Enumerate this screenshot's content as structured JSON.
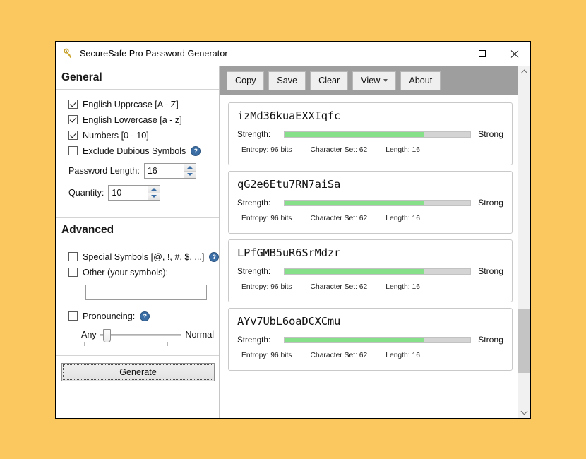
{
  "window": {
    "title": "SecureSafe Pro Password Generator",
    "icon": "key-icon",
    "controls": {
      "minimize": "minimize-icon",
      "maximize": "maximize-icon",
      "close": "close-icon"
    }
  },
  "sidebar": {
    "general": {
      "heading": "General",
      "checkboxes": [
        {
          "label": "English Upprcase [A - Z]",
          "checked": true,
          "help": false
        },
        {
          "label": "English Lowercase [a - z]",
          "checked": true,
          "help": false
        },
        {
          "label": "Numbers [0 - 10]",
          "checked": true,
          "help": false
        },
        {
          "label": "Exclude Dubious Symbols",
          "checked": false,
          "help": true
        }
      ],
      "fields": [
        {
          "label": "Password Length:",
          "value": "16"
        },
        {
          "label": "Quantity:",
          "value": "10"
        }
      ]
    },
    "advanced": {
      "heading": "Advanced",
      "checkboxes": [
        {
          "label": "Special Symbols [@, !, #, $, ...]",
          "checked": false,
          "help": true
        },
        {
          "label": "Other (your symbols):",
          "checked": false,
          "help": false
        }
      ],
      "symbols_input": {
        "value": "",
        "placeholder": ""
      },
      "pronouncing": {
        "label": "Pronouncing:",
        "checked": false,
        "help": true,
        "slider_min_label": "Any",
        "slider_max_label": "Normal",
        "slider_value": 4
      }
    },
    "generate_button": "Generate"
  },
  "toolbar": {
    "buttons": [
      {
        "label": "Copy",
        "dropdown": false
      },
      {
        "label": "Save",
        "dropdown": false
      },
      {
        "label": "Clear",
        "dropdown": false
      },
      {
        "label": "View",
        "dropdown": true
      },
      {
        "label": "About",
        "dropdown": false
      }
    ]
  },
  "results": {
    "strength_label": "Strength:",
    "entropy_prefix": "Entropy:",
    "charset_prefix": "Character Set:",
    "length_prefix": "Length:",
    "passwords": [
      {
        "password": "izMd36kuaEXXIqfc",
        "strength_word": "Strong",
        "strength_pct": 75,
        "entropy": "Entropy: 96  bits",
        "charset": "Character Set: 62",
        "length": "Length: 16"
      },
      {
        "password": "qG2e6Etu7RN7aiSa",
        "strength_word": "Strong",
        "strength_pct": 75,
        "entropy": "Entropy: 96  bits",
        "charset": "Character Set: 62",
        "length": "Length: 16"
      },
      {
        "password": "LPfGMB5uR6SrMdzr",
        "strength_word": "Strong",
        "strength_pct": 75,
        "entropy": "Entropy: 96  bits",
        "charset": "Character Set: 62",
        "length": "Length: 16"
      },
      {
        "password": "AYv7UbL6oaDCXCmu",
        "strength_word": "Strong",
        "strength_pct": 75,
        "entropy": "Entropy: 96  bits",
        "charset": "Character Set: 62",
        "length": "Length: 16"
      }
    ]
  },
  "scrollbar": {
    "up_arrow": "chevron-up-icon",
    "down_arrow": "chevron-down-icon"
  },
  "colors": {
    "desktop_background": "#FBC85F",
    "toolbar_background": "#9E9E9E",
    "strength_fill": "#86E08A",
    "strength_track": "#D4D4D4",
    "help_icon": "#3A6EA5",
    "spinner_arrow": "#3A6EA5"
  }
}
